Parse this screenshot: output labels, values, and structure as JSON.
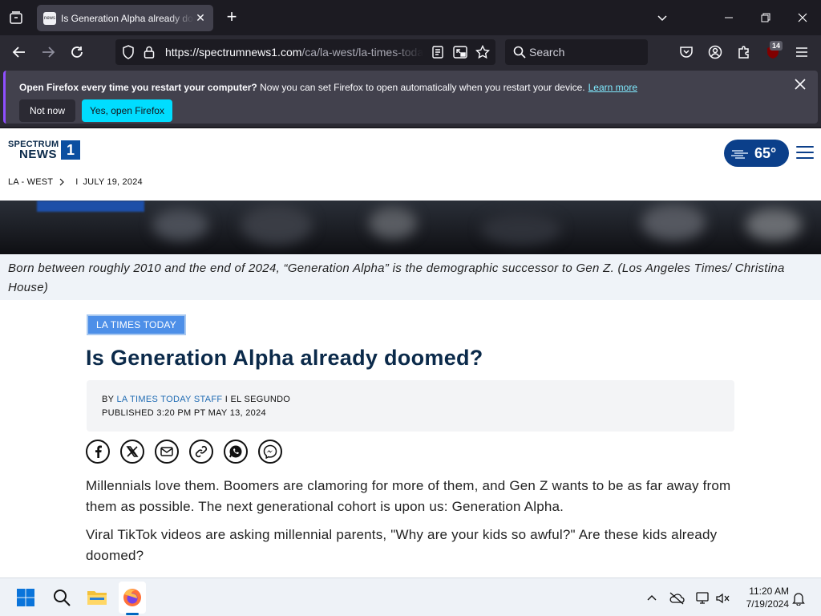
{
  "browser": {
    "tab_title": "Is Generation Alpha already doomed?",
    "tab_favicon_text": "news",
    "new_tab_label": "+",
    "url_host": "https://spectrumnews1.com",
    "url_path": "/ca/la-west/la-times-today/",
    "search_placeholder": "Search",
    "extension_badge": "14"
  },
  "notification": {
    "bold_text": "Open Firefox every time you restart your computer?",
    "text": " Now you can set Firefox to open automatically when you restart your device.",
    "link": "Learn more",
    "not_now": "Not now",
    "yes": "Yes, open Firefox"
  },
  "site": {
    "logo_top": "SPECTRUM",
    "logo_news": "NEWS",
    "logo_number": "1",
    "weather_temp": "65°",
    "breadcrumb_region": "LA - WEST",
    "breadcrumb_sep": "I",
    "breadcrumb_date": "JULY 19, 2024"
  },
  "article": {
    "caption": "Born between roughly 2010 and the end of 2024, “Generation Alpha” is the demographic successor to Gen Z. (Los Angeles Times/ Christina House)",
    "tag": "LA TIMES TODAY",
    "headline": "Is Generation Alpha already doomed?",
    "byline_prefix": "BY ",
    "byline_author": "LA TIMES TODAY STAFF",
    "byline_location": " I EL SEGUNDO",
    "published": "PUBLISHED 3:20 PM PT MAY 13, 2024",
    "paragraphs": [
      "Millennials love them. Boomers are clamoring for more of them, and Gen Z wants to be as far away from them as possible. The next generational cohort is upon us: Generation Alpha.",
      "Viral TikTok videos are asking millennial parents, \"Why are your kids so awful?\" Are these kids already doomed?"
    ]
  },
  "taskbar": {
    "time": "11:20 AM",
    "date": "7/19/2024"
  }
}
